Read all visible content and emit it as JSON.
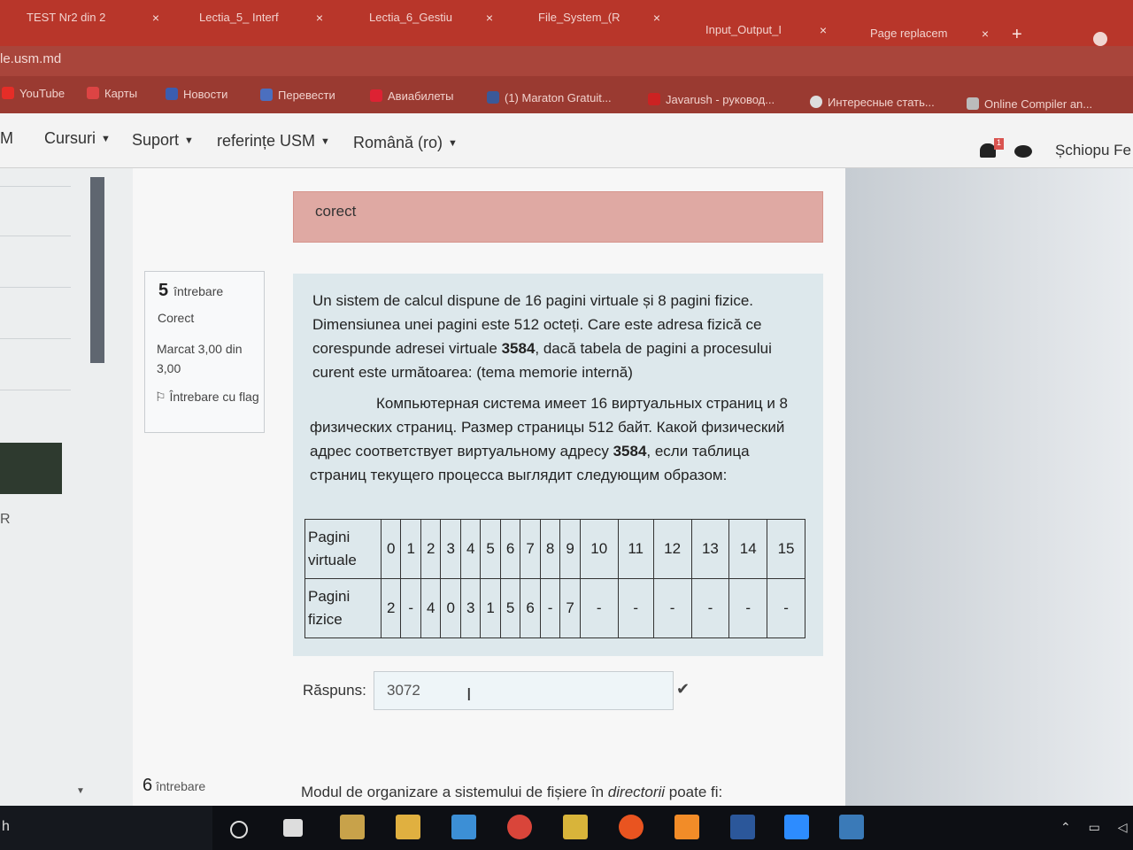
{
  "browser": {
    "tabs": [
      {
        "label": "TEST Nr2 din 2"
      },
      {
        "label": "Lectia_5_ Interf"
      },
      {
        "label": "Lectia_6_Gestiu"
      },
      {
        "label": "File_System_(R"
      },
      {
        "label": "Input_Output_I"
      },
      {
        "label": "Page replacem"
      }
    ],
    "close_glyph": "×",
    "new_tab_glyph": "+",
    "url": "le.usm.md",
    "bookmarks": [
      {
        "label": "YouTube",
        "icon": "youtube-icon",
        "color": "#e52d27"
      },
      {
        "label": "Карты",
        "icon": "maps-icon",
        "color": "#d44"
      },
      {
        "label": "Новости",
        "icon": "news-icon",
        "color": "#3b5db0"
      },
      {
        "label": "Перевести",
        "icon": "translate-icon",
        "color": "#4b6fbf"
      },
      {
        "label": "Авиабилеты",
        "icon": "plane-icon",
        "color": "#d23"
      },
      {
        "label": "(1) Maraton Gratuit...",
        "icon": "facebook-icon",
        "color": "#3b5998"
      },
      {
        "label": "Javarush - руковод...",
        "icon": "javarush-icon",
        "color": "#c22"
      },
      {
        "label": "Интересные стать...",
        "icon": "globe-icon",
        "color": "#ddd"
      },
      {
        "label": "Online Compiler an...",
        "icon": "ide-icon",
        "color": "#bbb"
      }
    ]
  },
  "navbar": {
    "brand": "M",
    "items": [
      {
        "label": "Cursuri"
      },
      {
        "label": "Suport"
      },
      {
        "label": "referințe USM"
      },
      {
        "label": "Română (ro)"
      }
    ],
    "caret": "▼",
    "notification_count": "1",
    "user": "Șchiopu Fe"
  },
  "drawer": {
    "fragment": "R"
  },
  "question5": {
    "feedback": "corect",
    "number": "5",
    "label": "întrebare",
    "status": "Corect",
    "mark": "Marcat 3,00 din 3,00",
    "flag": "Întrebare cu flag",
    "text_ro_before": "Un sistem de calcul dispune de 16 pagini virtuale și 8 pagini fizice. Dimensiunea unei pagini este 512 octeți. Care este adresa fizică ce corespunde adresei virtuale ",
    "address": "3584",
    "text_ro_after": ", dacă tabela de pagini a procesului curent este următoarea:   (tema memorie internă)",
    "text_ru_before": "Компьютерная система имеет 16 виртуальных страниц и 8 физических страниц. Размер страницы 512 байт. Какой физический адрес соответствует виртуальному адресу ",
    "text_ru_after": ", если таблица страниц текущего процесса выглядит следующим образом:",
    "table": {
      "row1_header": "Pagini virtuale",
      "row2_header": "Pagini fizice",
      "virtual": [
        "0",
        "1",
        "2",
        "3",
        "4",
        "5",
        "6",
        "7",
        "8",
        "9",
        "10",
        "11",
        "12",
        "13",
        "14",
        "15"
      ],
      "physical": [
        "2",
        "-",
        "4",
        "0",
        "3",
        "1",
        "5",
        "6",
        "-",
        "7",
        "-",
        "-",
        "-",
        "-",
        "-",
        "-"
      ]
    },
    "answer_label": "Răspuns:",
    "answer_value": "3072",
    "check_glyph": "✔"
  },
  "question6": {
    "number": "6",
    "label": "întrebare",
    "text_before": "Modul de organizare a sistemului de fișiere în ",
    "text_em": "directorii",
    "text_after": " poate fi:"
  },
  "taskbar": {
    "fragment": "h",
    "apps": [
      {
        "icon": "task-view-icon",
        "color": "#ddd"
      },
      {
        "icon": "notepad-icon",
        "color": "#c8a24a"
      },
      {
        "icon": "file-explorer-icon",
        "color": "#e0b040"
      },
      {
        "icon": "store-icon",
        "color": "#3c8fd6"
      },
      {
        "icon": "chrome-icon",
        "color": "#d9453a"
      },
      {
        "icon": "archive-icon",
        "color": "#d8b43a"
      },
      {
        "icon": "ubuntu-icon",
        "color": "#e95420"
      },
      {
        "icon": "sublime-icon",
        "color": "#f28c28"
      },
      {
        "icon": "word-icon",
        "color": "#2b579a"
      },
      {
        "icon": "zoom-icon",
        "color": "#2d8cff"
      },
      {
        "icon": "photos-icon",
        "color": "#3a7ab8"
      }
    ],
    "tray": "⌃ ▭ ◁×"
  }
}
